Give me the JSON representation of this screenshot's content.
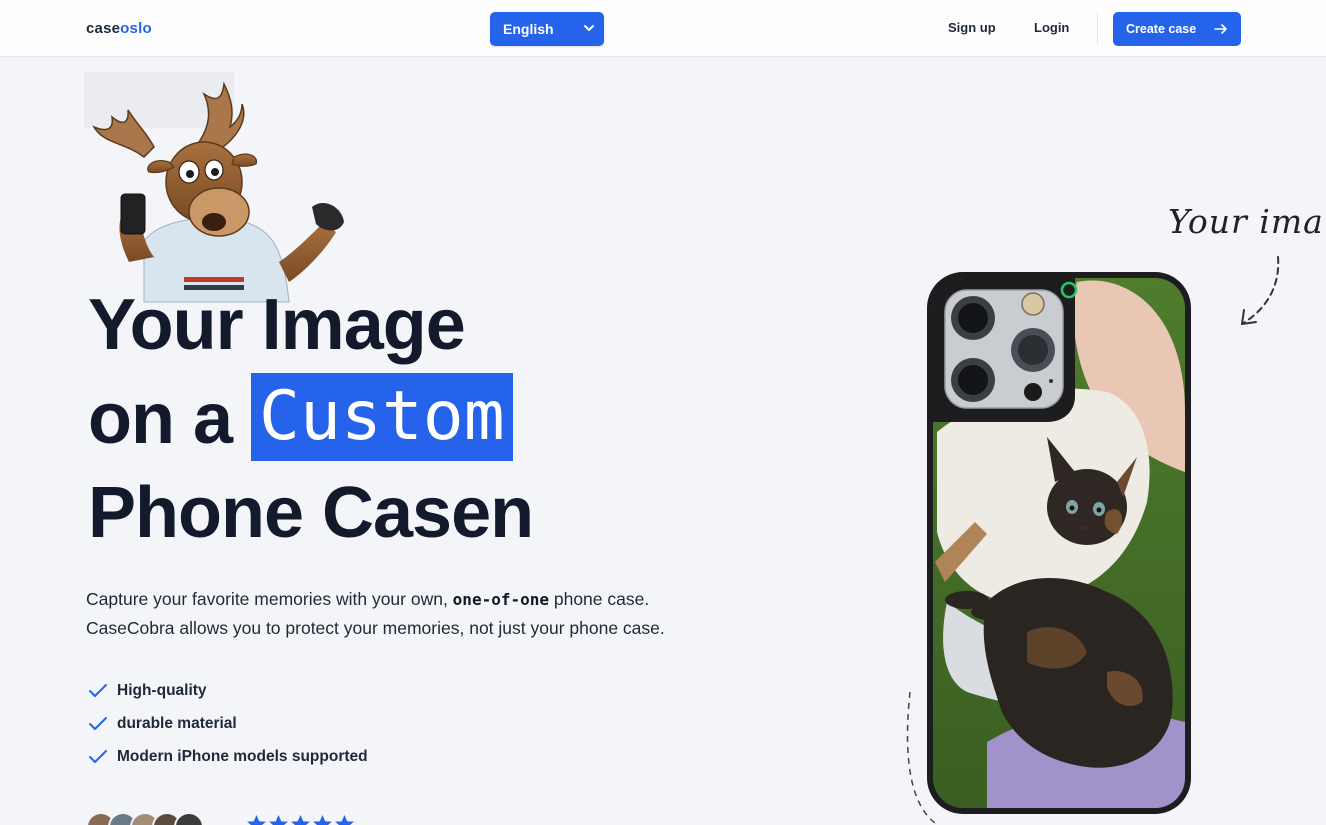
{
  "navbar": {
    "logo_part1": "case",
    "logo_part2": "oslo",
    "language": "English",
    "signup": "Sign up",
    "login": "Login",
    "create_case": "Create case"
  },
  "hero": {
    "line1": "Your Image",
    "line2_prefix": "on a ",
    "highlight": "Custom",
    "line3": "Phone Casen",
    "desc_part1": "Capture your favorite memories with your own, ",
    "desc_code": "one-of-one",
    "desc_part2": " phone case.",
    "desc_line2": "CaseCobra allows you to protect your memories, not just your phone case.",
    "features": [
      "High-quality",
      "durable material",
      "Modern iPhone models supported"
    ],
    "rating_stars": 5
  },
  "annotation": "Your ima",
  "colors": {
    "accent": "#2563eb",
    "heading": "#121a2c",
    "background": "#f3f5f8"
  },
  "icons": [
    "chevron-down-icon",
    "arrow-right-icon",
    "check-icon",
    "star-icon",
    "camera-icon"
  ]
}
